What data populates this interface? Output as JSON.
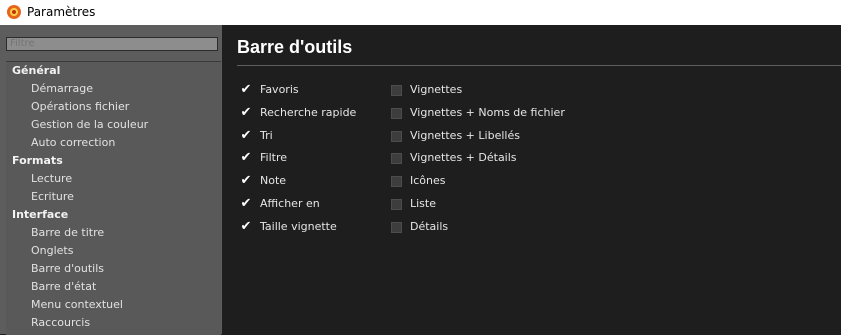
{
  "window": {
    "title": "Paramètres"
  },
  "sidebar": {
    "filter_placeholder": "Filtre",
    "tree": [
      {
        "type": "group",
        "label": "Général"
      },
      {
        "type": "item",
        "label": "Démarrage"
      },
      {
        "type": "item",
        "label": "Opérations fichier"
      },
      {
        "type": "item",
        "label": "Gestion de la couleur"
      },
      {
        "type": "item",
        "label": "Auto correction"
      },
      {
        "type": "group",
        "label": "Formats"
      },
      {
        "type": "item",
        "label": "Lecture"
      },
      {
        "type": "item",
        "label": "Ecriture"
      },
      {
        "type": "group",
        "label": "Interface"
      },
      {
        "type": "item",
        "label": "Barre de titre"
      },
      {
        "type": "item",
        "label": "Onglets"
      },
      {
        "type": "item",
        "label": "Barre d'outils"
      },
      {
        "type": "item",
        "label": "Barre d'état"
      },
      {
        "type": "item",
        "label": "Menu contextuel"
      },
      {
        "type": "item",
        "label": "Raccourcis"
      }
    ]
  },
  "main": {
    "heading": "Barre d'outils",
    "left_options": [
      {
        "label": "Favoris",
        "checked": true
      },
      {
        "label": "Recherche rapide",
        "checked": true
      },
      {
        "label": "Tri",
        "checked": true
      },
      {
        "label": "Filtre",
        "checked": true
      },
      {
        "label": "Note",
        "checked": true
      },
      {
        "label": "Afficher en",
        "checked": true
      },
      {
        "label": "Taille vignette",
        "checked": true
      }
    ],
    "right_options": [
      {
        "label": "Vignettes",
        "checked": false
      },
      {
        "label": "Vignettes + Noms de fichier",
        "checked": false
      },
      {
        "label": "Vignettes + Libellés",
        "checked": false
      },
      {
        "label": "Vignettes + Détails",
        "checked": false
      },
      {
        "label": "Icônes",
        "checked": false
      },
      {
        "label": "Liste",
        "checked": false
      },
      {
        "label": "Détails",
        "checked": false
      }
    ]
  },
  "colors": {
    "background": "#1e1e1e",
    "sidebar": "#5d5d5d",
    "text": "#e6e6e6"
  },
  "icons": {
    "app": "settings-gear-app-icon",
    "checked": "checkmark-icon",
    "unchecked": "empty-checkbox-icon"
  }
}
